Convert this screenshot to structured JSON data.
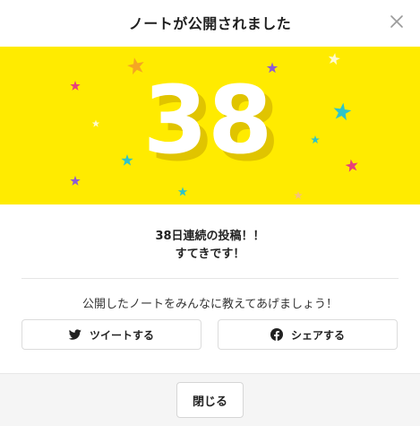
{
  "dialog": {
    "title": "ノートが公開されました",
    "close_icon": "close-icon"
  },
  "banner": {
    "background": "#FFEB00",
    "number": "38",
    "star_colors": [
      "#F5A623",
      "#8E5BD3",
      "#E8407A",
      "#2EC4C9",
      "#FFFBD0",
      "#F7C27B"
    ]
  },
  "message": {
    "line1": "38日連続の投稿！！",
    "line2": "すてきです！"
  },
  "share": {
    "prompt": "公開したノートをみんなに教えてあげましょう！",
    "tweet_label": "ツイートする",
    "tweet_icon": "twitter-icon",
    "facebook_label": "シェアする",
    "facebook_icon": "facebook-icon"
  },
  "footer": {
    "close_label": "閉じる"
  }
}
